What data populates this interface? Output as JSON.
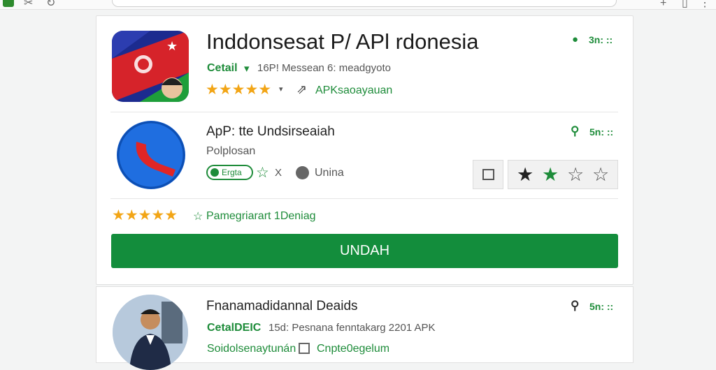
{
  "browser": {
    "left_icons": [
      "app-icon",
      "scissors-icon",
      "refresh-icon"
    ],
    "right_icons": [
      "plus-icon",
      "book-icon",
      "menu-icon"
    ]
  },
  "app1": {
    "title": "Inddonsesat P/ APl rdonesia",
    "detail_label": "Cetail",
    "detail_text": "16P! Messean 6: meadgyoto",
    "stars_text": "★★★★★",
    "link_text": "APKsaoayauan",
    "side_text": "3n: ::"
  },
  "app2": {
    "title": "ApP: tte Undsirseaiah",
    "subtitle": "Polplosan",
    "chip_label": "Ergta",
    "x_text": "X",
    "region_text": "Unina",
    "side_text": "5n: ::",
    "rating_stars": 2
  },
  "rating_row": {
    "text": "Pamegriarart 1Deniag"
  },
  "install_button": {
    "label": "UNDAH"
  },
  "app3": {
    "title": "Fnanamadidannal Deaids",
    "label": "CetalDEIC",
    "detail_text": "15d: Pesnana fenntakarg 2201 APK",
    "footer_left": "Soidolsenaytunán",
    "footer_right": "Cnpte0egelum",
    "side_text": "5n: ::"
  },
  "colors": {
    "accent_green": "#138d3c",
    "star_orange": "#f2a516"
  }
}
